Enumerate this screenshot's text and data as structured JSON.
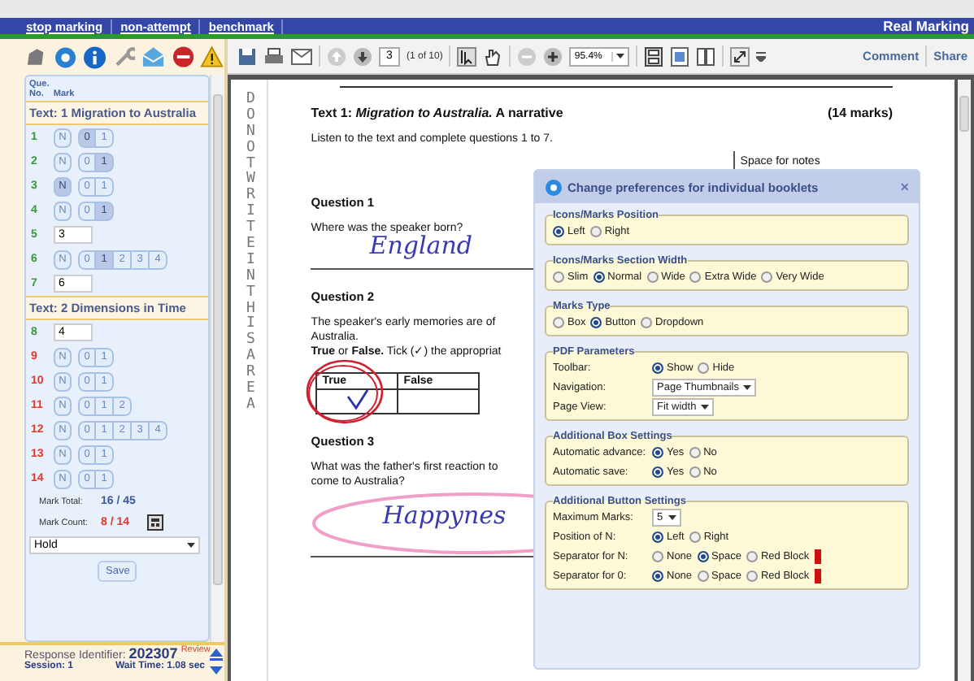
{
  "top_bar": {
    "links": [
      "stop marking",
      "non-attempt",
      "benchmark"
    ],
    "title": "Real Marking"
  },
  "marks_panel": {
    "heading_que": "Que.",
    "heading_no": "No.",
    "heading_mark": "Mark",
    "sections": [
      {
        "title": "Text: 1 Migration to Australia",
        "questions": [
          {
            "number": "1",
            "marked": true,
            "kind": "buttons",
            "n": {
              "label": "N",
              "selected": false
            },
            "marks": [
              {
                "label": "0",
                "selected": true
              },
              {
                "label": "1",
                "selected": false
              }
            ]
          },
          {
            "number": "2",
            "marked": true,
            "kind": "buttons",
            "n": {
              "label": "N",
              "selected": false
            },
            "marks": [
              {
                "label": "0",
                "selected": false
              },
              {
                "label": "1",
                "selected": true
              }
            ]
          },
          {
            "number": "3",
            "marked": true,
            "kind": "buttons",
            "n": {
              "label": "N",
              "selected": true
            },
            "marks": [
              {
                "label": "0",
                "selected": false
              },
              {
                "label": "1",
                "selected": false
              }
            ]
          },
          {
            "number": "4",
            "marked": true,
            "kind": "buttons",
            "n": {
              "label": "N",
              "selected": false
            },
            "marks": [
              {
                "label": "0",
                "selected": false
              },
              {
                "label": "1",
                "selected": true
              }
            ]
          },
          {
            "number": "5",
            "marked": true,
            "kind": "input",
            "value": "3"
          },
          {
            "number": "6",
            "marked": true,
            "kind": "buttons",
            "n": {
              "label": "N",
              "selected": false
            },
            "marks": [
              {
                "label": "0",
                "selected": false
              },
              {
                "label": "1",
                "selected": true
              },
              {
                "label": "2",
                "selected": false
              },
              {
                "label": "3",
                "selected": false
              },
              {
                "label": "4",
                "selected": false
              }
            ]
          },
          {
            "number": "7",
            "marked": true,
            "kind": "input",
            "value": "6"
          }
        ]
      },
      {
        "title": "Text: 2 Dimensions in Time",
        "questions": [
          {
            "number": "8",
            "marked": true,
            "kind": "input",
            "value": "4"
          },
          {
            "number": "9",
            "marked": false,
            "kind": "buttons",
            "n": {
              "label": "N",
              "selected": false
            },
            "marks": [
              {
                "label": "0",
                "selected": false
              },
              {
                "label": "1",
                "selected": false
              }
            ]
          },
          {
            "number": "10",
            "marked": false,
            "kind": "buttons",
            "n": {
              "label": "N",
              "selected": false
            },
            "marks": [
              {
                "label": "0",
                "selected": false
              },
              {
                "label": "1",
                "selected": false
              }
            ]
          },
          {
            "number": "11",
            "marked": false,
            "kind": "buttons",
            "n": {
              "label": "N",
              "selected": false
            },
            "marks": [
              {
                "label": "0",
                "selected": false
              },
              {
                "label": "1",
                "selected": false
              },
              {
                "label": "2",
                "selected": false
              }
            ]
          },
          {
            "number": "12",
            "marked": false,
            "kind": "buttons",
            "n": {
              "label": "N",
              "selected": false
            },
            "marks": [
              {
                "label": "0",
                "selected": false
              },
              {
                "label": "1",
                "selected": false
              },
              {
                "label": "2",
                "selected": false
              },
              {
                "label": "3",
                "selected": false
              },
              {
                "label": "4",
                "selected": false
              }
            ]
          },
          {
            "number": "13",
            "marked": false,
            "kind": "buttons",
            "n": {
              "label": "N",
              "selected": false
            },
            "marks": [
              {
                "label": "0",
                "selected": false
              },
              {
                "label": "1",
                "selected": false
              }
            ]
          },
          {
            "number": "14",
            "marked": false,
            "kind": "buttons",
            "n": {
              "label": "N",
              "selected": false
            },
            "marks": [
              {
                "label": "0",
                "selected": false
              },
              {
                "label": "1",
                "selected": false
              }
            ]
          }
        ]
      }
    ],
    "mark_total_label": "Mark Total:",
    "mark_total": "16 / 45",
    "mark_count_label": "Mark Count:",
    "mark_count": "8 / 14",
    "status_select": "Hold",
    "save_button": "Save"
  },
  "footer": {
    "identifier_label": "Response Identifier:",
    "identifier": "202307",
    "review": "Review",
    "session": "Session: 1",
    "wait_time": "Wait Time: 1.08 sec"
  },
  "toolbar": {
    "page": "3",
    "page_count": "(1 of 10)",
    "zoom": "95.4%",
    "comment": "Comment",
    "share": "Share"
  },
  "document": {
    "margin_text": "DO NOT WRITE IN THIS AREA",
    "heading": "**Text 1:  *Migration to Australia.*  A narrative**",
    "marks": "(14 marks)",
    "instruction": "Listen to the text and complete questions 1 to 7.",
    "notes": "Space for notes",
    "q1_title": "Question 1",
    "q1_text": "Where was the speaker born?",
    "q1_answer": "England",
    "q2_title": "Question 2",
    "q2_text_1": "The speaker's early memories are of",
    "q2_text_2": "Australia.",
    "q2_text_3": "**True** or **False.** Tick (✓) the appropriat",
    "q2_table": [
      {
        "label": "True",
        "ticked": true
      },
      {
        "label": "False",
        "ticked": false
      }
    ],
    "q3_title": "Question 3",
    "q3_text_1": "What was the father's first reaction to",
    "q3_text_2": "come to Australia?",
    "q3_answer": "Happynes"
  },
  "dialog": {
    "title": "Change preferences for individual booklets",
    "close": "×",
    "groups": [
      {
        "legend": "Icons/Marks Position",
        "rows": [
          {
            "kind": "radio",
            "swatch": false,
            "options": [
              {
                "label": "Left",
                "selected": true
              },
              {
                "label": "Right",
                "selected": false
              }
            ]
          }
        ]
      },
      {
        "legend": "Icons/Marks Section Width",
        "rows": [
          {
            "kind": "radio",
            "swatch": false,
            "options": [
              {
                "label": "Slim",
                "selected": false
              },
              {
                "label": "Normal",
                "selected": true
              },
              {
                "label": "Wide",
                "selected": false
              },
              {
                "label": "Extra Wide",
                "selected": false
              },
              {
                "label": "Very Wide",
                "selected": false
              }
            ]
          }
        ]
      },
      {
        "legend": "Marks Type",
        "rows": [
          {
            "kind": "radio",
            "swatch": false,
            "options": [
              {
                "label": "Box",
                "selected": false
              },
              {
                "label": "Button",
                "selected": true
              },
              {
                "label": "Dropdown",
                "selected": false
              }
            ]
          }
        ]
      },
      {
        "legend": "PDF Parameters",
        "rows": [
          {
            "kind": "radio",
            "label": "Toolbar:",
            "swatch": false,
            "options": [
              {
                "label": "Show",
                "selected": true
              },
              {
                "label": "Hide",
                "selected": false
              }
            ]
          },
          {
            "kind": "select",
            "label": "Navigation:",
            "value": "Page Thumbnails"
          },
          {
            "kind": "select",
            "label": "Page View:",
            "value": "Fit width"
          }
        ]
      },
      {
        "legend": "Additional Box Settings",
        "rows": [
          {
            "kind": "radio",
            "label": "Automatic advance:",
            "swatch": false,
            "options": [
              {
                "label": "Yes",
                "selected": true
              },
              {
                "label": "No",
                "selected": false
              }
            ]
          },
          {
            "kind": "radio",
            "label": "Automatic save:",
            "swatch": false,
            "options": [
              {
                "label": "Yes",
                "selected": true
              },
              {
                "label": "No",
                "selected": false
              }
            ]
          }
        ]
      },
      {
        "legend": "Additional Button Settings",
        "rows": [
          {
            "kind": "select",
            "label": "Maximum Marks:",
            "value": "5"
          },
          {
            "kind": "radio",
            "label": "Position of N:",
            "swatch": false,
            "options": [
              {
                "label": "Left",
                "selected": true
              },
              {
                "label": "Right",
                "selected": false
              }
            ]
          },
          {
            "kind": "radio",
            "label": "Separator for N:",
            "swatch": true,
            "options": [
              {
                "label": "None",
                "selected": false
              },
              {
                "label": "Space",
                "selected": true
              },
              {
                "label": "Red Block",
                "selected": false
              }
            ]
          },
          {
            "kind": "radio",
            "label": "Separator for 0:",
            "swatch": true,
            "options": [
              {
                "label": "None",
                "selected": true
              },
              {
                "label": "Space",
                "selected": false
              },
              {
                "label": "Red Block",
                "selected": false
              }
            ]
          }
        ]
      }
    ]
  }
}
